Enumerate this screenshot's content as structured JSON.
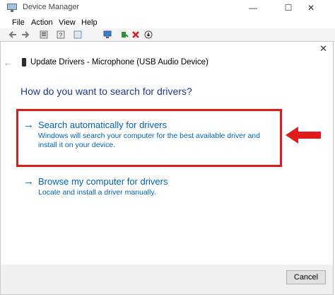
{
  "background_window": {
    "title": "Device Manager",
    "menu": [
      "File",
      "Action",
      "View",
      "Help"
    ],
    "controls": {
      "minimize": "—",
      "maximize": "☐",
      "close": "✕"
    }
  },
  "dialog": {
    "back_glyph": "←",
    "title": "Update Drivers - Microphone (USB Audio Device)",
    "close_glyph": "✕",
    "heading": "How do you want to search for drivers?",
    "options": [
      {
        "title": "Search automatically for drivers",
        "description": "Windows will search your computer for the best available driver and install it on your device."
      },
      {
        "title": "Browse my computer for drivers",
        "description": "Locate and install a driver manually."
      }
    ],
    "cancel_label": "Cancel"
  },
  "colors": {
    "link_blue": "#0063b1",
    "heading_blue": "#1e3a8a",
    "highlight_red": "#e01b1b"
  },
  "icons": {
    "arrow": "→"
  }
}
